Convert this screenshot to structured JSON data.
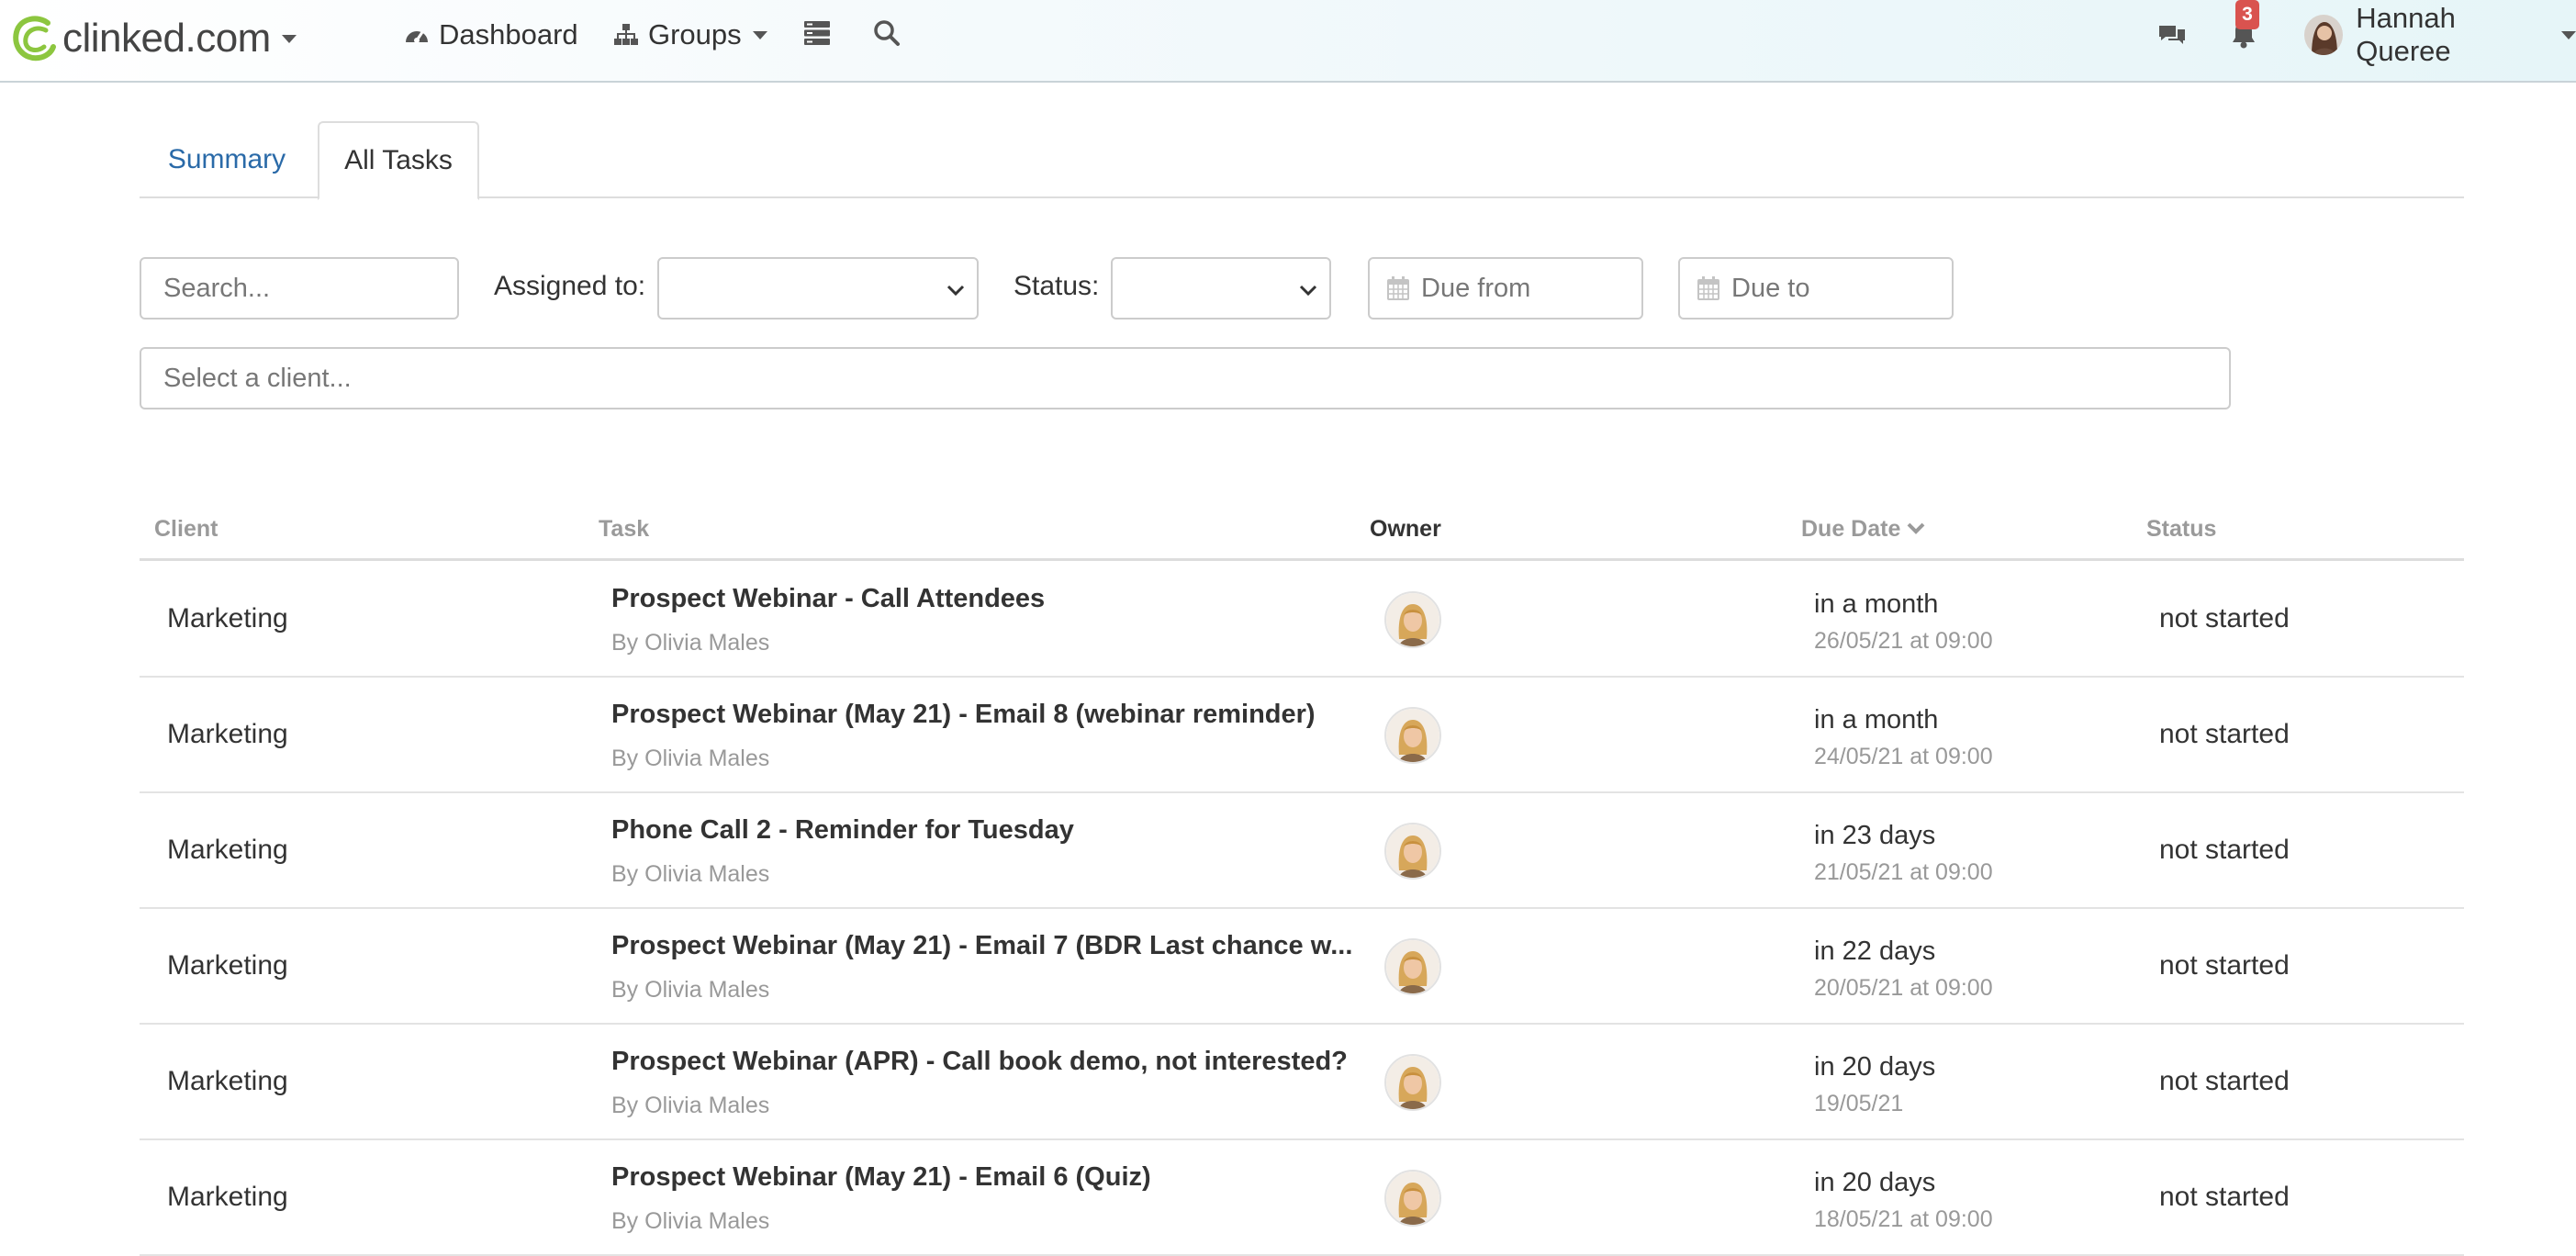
{
  "brand": {
    "name": "clinked.com",
    "accent": "#8cc63f"
  },
  "nav": {
    "dashboard": "Dashboard",
    "groups": "Groups",
    "notifications_count": "3",
    "user_name": "Hannah Queree"
  },
  "tabs": [
    {
      "label": "Summary",
      "active": false
    },
    {
      "label": "All Tasks",
      "active": true
    }
  ],
  "filters": {
    "search_placeholder": "Search...",
    "assigned_label": "Assigned to:",
    "assigned_value": "",
    "status_label": "Status:",
    "status_value": "",
    "due_from_placeholder": "Due from",
    "due_to_placeholder": "Due to",
    "client_placeholder": "Select a client..."
  },
  "table": {
    "headers": {
      "client": "Client",
      "task": "Task",
      "owner": "Owner",
      "due_date": "Due Date",
      "status": "Status"
    },
    "rows": [
      {
        "client": "Marketing",
        "title": "Prospect Webinar - Call Attendees",
        "by": "By Olivia Males",
        "due_rel": "in a month",
        "due_abs": "26/05/21 at 09:00",
        "status": "not started"
      },
      {
        "client": "Marketing",
        "title": "Prospect Webinar (May 21) - Email 8 (webinar reminder)",
        "by": "By Olivia Males",
        "due_rel": "in a month",
        "due_abs": "24/05/21 at 09:00",
        "status": "not started"
      },
      {
        "client": "Marketing",
        "title": "Phone Call 2 - Reminder for Tuesday",
        "by": "By Olivia Males",
        "due_rel": "in 23 days",
        "due_abs": "21/05/21 at 09:00",
        "status": "not started"
      },
      {
        "client": "Marketing",
        "title": "Prospect Webinar (May 21) - Email 7 (BDR Last chance w...",
        "by": "By Olivia Males",
        "due_rel": "in 22 days",
        "due_abs": "20/05/21 at 09:00",
        "status": "not started"
      },
      {
        "client": "Marketing",
        "title": "Prospect Webinar (APR) - Call book demo, not interested?",
        "by": "By Olivia Males",
        "due_rel": "in 20 days",
        "due_abs": "19/05/21",
        "status": "not started"
      },
      {
        "client": "Marketing",
        "title": "Prospect Webinar (May 21) - Email 6 (Quiz)",
        "by": "By Olivia Males",
        "due_rel": "in 20 days",
        "due_abs": "18/05/21 at 09:00",
        "status": "not started"
      }
    ]
  }
}
